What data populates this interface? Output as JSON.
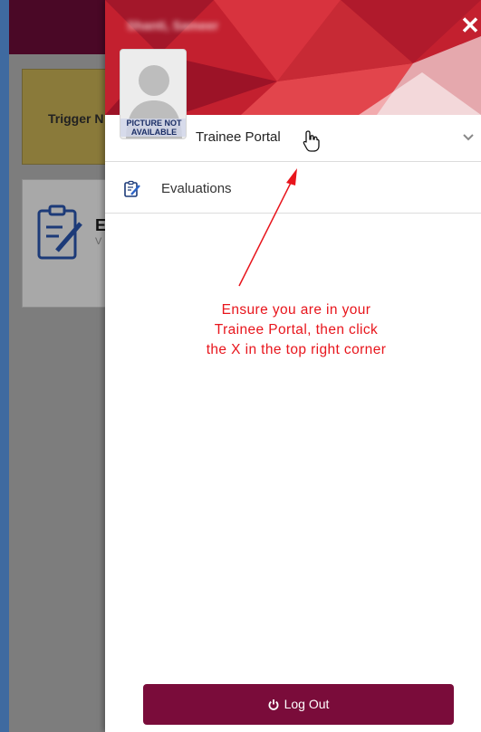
{
  "background_app": {
    "card_trigger_label": "Trigger N",
    "card_eval_title": "E",
    "card_eval_sub": "V"
  },
  "drawer": {
    "user_name": "Shanti, Sameer",
    "close_icon": "close-icon",
    "avatar_caption_line1": "PICTURE NOT",
    "avatar_caption_line2": "AVAILABLE",
    "portal_label": "Trainee Portal",
    "menu": [
      {
        "label": "Evaluations",
        "icon": "clipboard-edit-icon"
      }
    ],
    "logout_label": "Log Out"
  },
  "annotation": {
    "lines": [
      "Ensure you are in your",
      "Trainee Portal, then click",
      "the X in the top right corner"
    ],
    "color": "#e8151c"
  },
  "colors": {
    "banner_red": "#c2202e",
    "logout_button": "#7a0c3a",
    "header_maroon": "#4a0826"
  }
}
